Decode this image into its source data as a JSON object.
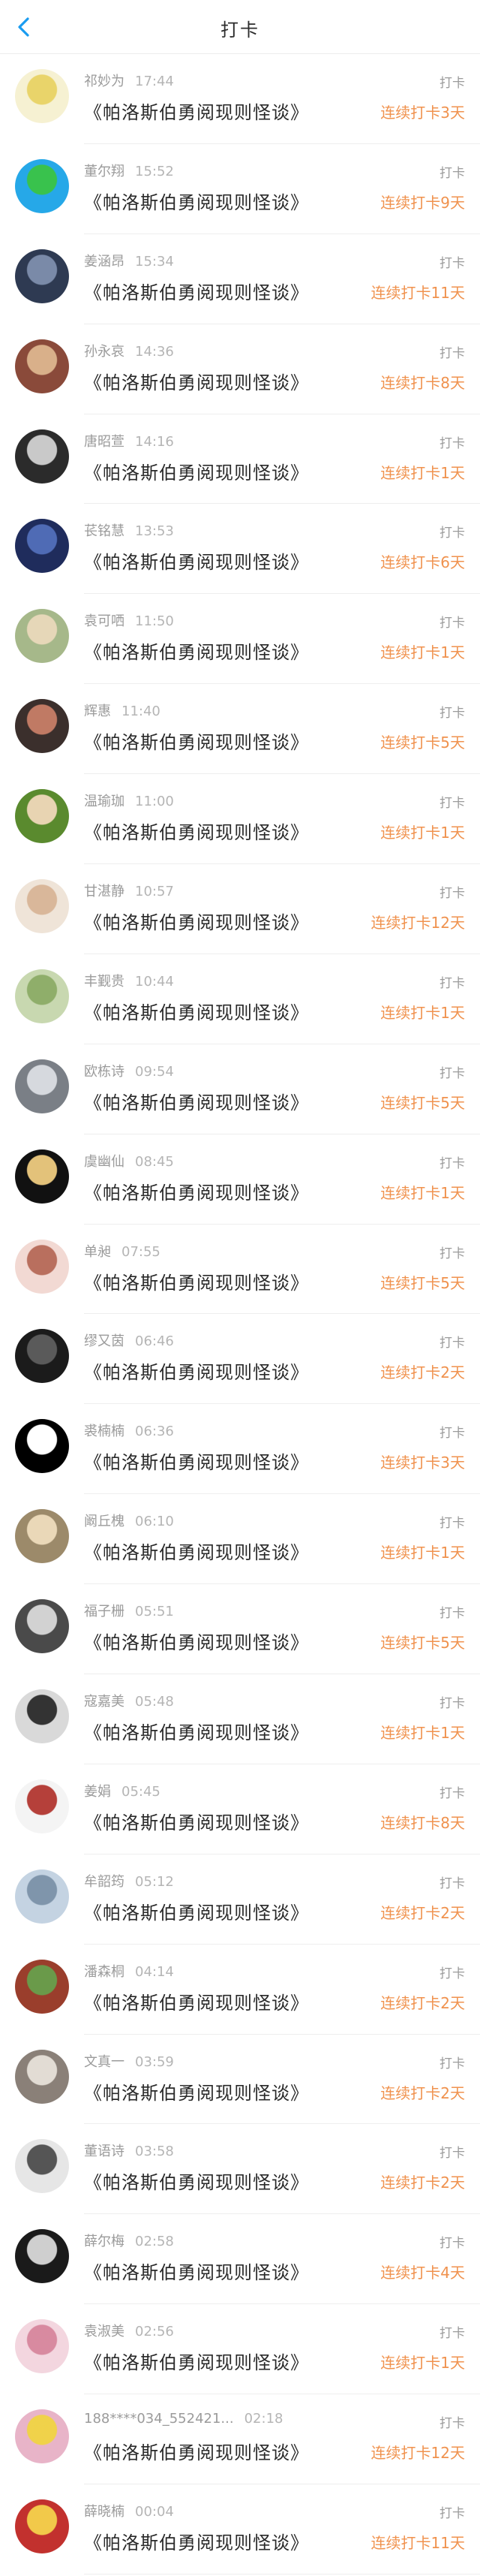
{
  "header": {
    "title": "打卡",
    "back_icon": "chevron-left-icon",
    "accent": "#1a9cf0"
  },
  "colors": {
    "streak": "#f0924e",
    "meta": "#9b9b9b"
  },
  "checkins": [
    {
      "name": "祁妙为",
      "time": "17:44",
      "book": "《帕洛斯伯勇阅现则怪谈》",
      "type": "打卡",
      "streak": "连续打卡3天",
      "avatar_bg": "#f6f1d2",
      "avatar_fg": "#e9d46a"
    },
    {
      "name": "董尔翔",
      "time": "15:52",
      "book": "《帕洛斯伯勇阅现则怪谈》",
      "type": "打卡",
      "streak": "连续打卡9天",
      "avatar_bg": "#26a8e8",
      "avatar_fg": "#39c24d"
    },
    {
      "name": "姜涵昂",
      "time": "15:34",
      "book": "《帕洛斯伯勇阅现则怪谈》",
      "type": "打卡",
      "streak": "连续打卡11天",
      "avatar_bg": "#2e3a52",
      "avatar_fg": "#7a8aa8"
    },
    {
      "name": "孙永哀",
      "time": "14:36",
      "book": "《帕洛斯伯勇阅现则怪谈》",
      "type": "打卡",
      "streak": "连续打卡8天",
      "avatar_bg": "#8a4a3a",
      "avatar_fg": "#d9b08a"
    },
    {
      "name": "唐昭萱",
      "time": "14:16",
      "book": "《帕洛斯伯勇阅现则怪谈》",
      "type": "打卡",
      "streak": "连续打卡1天",
      "avatar_bg": "#2b2b2b",
      "avatar_fg": "#c9c9c9"
    },
    {
      "name": "苌铭慧",
      "time": "13:53",
      "book": "《帕洛斯伯勇阅现则怪谈》",
      "type": "打卡",
      "streak": "连续打卡6天",
      "avatar_bg": "#1f2c5c",
      "avatar_fg": "#4f6bb5"
    },
    {
      "name": "袁可哂",
      "time": "11:50",
      "book": "《帕洛斯伯勇阅现则怪谈》",
      "type": "打卡",
      "streak": "连续打卡1天",
      "avatar_bg": "#a6b88a",
      "avatar_fg": "#e6d7b8"
    },
    {
      "name": "辉惠",
      "time": "11:40",
      "book": "《帕洛斯伯勇阅现则怪谈》",
      "type": "打卡",
      "streak": "连续打卡5天",
      "avatar_bg": "#3b2f2c",
      "avatar_fg": "#c07a64"
    },
    {
      "name": "温瑜珈",
      "time": "11:00",
      "book": "《帕洛斯伯勇阅现则怪谈》",
      "type": "打卡",
      "streak": "连续打卡1天",
      "avatar_bg": "#5a8a2e",
      "avatar_fg": "#e8d4b2"
    },
    {
      "name": "甘湛静",
      "time": "10:57",
      "book": "《帕洛斯伯勇阅现则怪谈》",
      "type": "打卡",
      "streak": "连续打卡12天",
      "avatar_bg": "#efe4d8",
      "avatar_fg": "#d9b79a"
    },
    {
      "name": "丰觐贵",
      "time": "10:44",
      "book": "《帕洛斯伯勇阅现则怪谈》",
      "type": "打卡",
      "streak": "连续打卡1天",
      "avatar_bg": "#c8d8b0",
      "avatar_fg": "#8fae6a"
    },
    {
      "name": "欧栋诗",
      "time": "09:54",
      "book": "《帕洛斯伯勇阅现则怪谈》",
      "type": "打卡",
      "streak": "连续打卡5天",
      "avatar_bg": "#7a7f86",
      "avatar_fg": "#d6d9de"
    },
    {
      "name": "虞幽仙",
      "time": "08:45",
      "book": "《帕洛斯伯勇阅现则怪谈》",
      "type": "打卡",
      "streak": "连续打卡1天",
      "avatar_bg": "#111111",
      "avatar_fg": "#e3c27a"
    },
    {
      "name": "单昶",
      "time": "07:55",
      "book": "《帕洛斯伯勇阅现则怪谈》",
      "type": "打卡",
      "streak": "连续打卡5天",
      "avatar_bg": "#f2d9d3",
      "avatar_fg": "#b96f5e"
    },
    {
      "name": "缪又茵",
      "time": "06:46",
      "book": "《帕洛斯伯勇阅现则怪谈》",
      "type": "打卡",
      "streak": "连续打卡2天",
      "avatar_bg": "#1b1b1b",
      "avatar_fg": "#5a5a5a"
    },
    {
      "name": "裘楠楠",
      "time": "06:36",
      "book": "《帕洛斯伯勇阅现则怪谈》",
      "type": "打卡",
      "streak": "连续打卡3天",
      "avatar_bg": "#000000",
      "avatar_fg": "#ffffff"
    },
    {
      "name": "阚丘槐",
      "time": "06:10",
      "book": "《帕洛斯伯勇阅现则怪谈》",
      "type": "打卡",
      "streak": "连续打卡1天",
      "avatar_bg": "#9c8a6a",
      "avatar_fg": "#ead8b8"
    },
    {
      "name": "福子栅",
      "time": "05:51",
      "book": "《帕洛斯伯勇阅现则怪谈》",
      "type": "打卡",
      "streak": "连续打卡5天",
      "avatar_bg": "#4a4a4a",
      "avatar_fg": "#d2d2d2"
    },
    {
      "name": "寇嘉美",
      "time": "05:48",
      "book": "《帕洛斯伯勇阅现则怪谈》",
      "type": "打卡",
      "streak": "连续打卡1天",
      "avatar_bg": "#d9d9d9",
      "avatar_fg": "#333333"
    },
    {
      "name": "姜娟",
      "time": "05:45",
      "book": "《帕洛斯伯勇阅现则怪谈》",
      "type": "打卡",
      "streak": "连续打卡8天",
      "avatar_bg": "#f4f4f4",
      "avatar_fg": "#b5403a"
    },
    {
      "name": "牟韶筠",
      "time": "05:12",
      "book": "《帕洛斯伯勇阅现则怪谈》",
      "type": "打卡",
      "streak": "连续打卡2天",
      "avatar_bg": "#c4d3e2",
      "avatar_fg": "#7f95ab"
    },
    {
      "name": "潘森桐",
      "time": "04:14",
      "book": "《帕洛斯伯勇阅现则怪谈》",
      "type": "打卡",
      "streak": "连续打卡2天",
      "avatar_bg": "#9a3e2c",
      "avatar_fg": "#6a9a4a"
    },
    {
      "name": "文真一",
      "time": "03:59",
      "book": "《帕洛斯伯勇阅现则怪谈》",
      "type": "打卡",
      "streak": "连续打卡2天",
      "avatar_bg": "#8a8078",
      "avatar_fg": "#e2dcd4"
    },
    {
      "name": "董语诗",
      "time": "03:58",
      "book": "《帕洛斯伯勇阅现则怪谈》",
      "type": "打卡",
      "streak": "连续打卡2天",
      "avatar_bg": "#e6e6e6",
      "avatar_fg": "#555555"
    },
    {
      "name": "薛尔梅",
      "time": "02:58",
      "book": "《帕洛斯伯勇阅现则怪谈》",
      "type": "打卡",
      "streak": "连续打卡4天",
      "avatar_bg": "#1a1a1a",
      "avatar_fg": "#cfcfcf"
    },
    {
      "name": "袁淑美",
      "time": "02:56",
      "book": "《帕洛斯伯勇阅现则怪谈》",
      "type": "打卡",
      "streak": "连续打卡1天",
      "avatar_bg": "#f3d6df",
      "avatar_fg": "#d88aa0"
    },
    {
      "name": "188****034_552421...",
      "time": "02:18",
      "book": "《帕洛斯伯勇阅现则怪谈》",
      "type": "打卡",
      "streak": "连续打卡12天",
      "avatar_bg": "#e8b4c8",
      "avatar_fg": "#f0d24a"
    },
    {
      "name": "薛晓楠",
      "time": "00:04",
      "book": "《帕洛斯伯勇阅现则怪谈》",
      "type": "打卡",
      "streak": "连续打卡11天",
      "avatar_bg": "#c2312e",
      "avatar_fg": "#f2c94a"
    }
  ]
}
